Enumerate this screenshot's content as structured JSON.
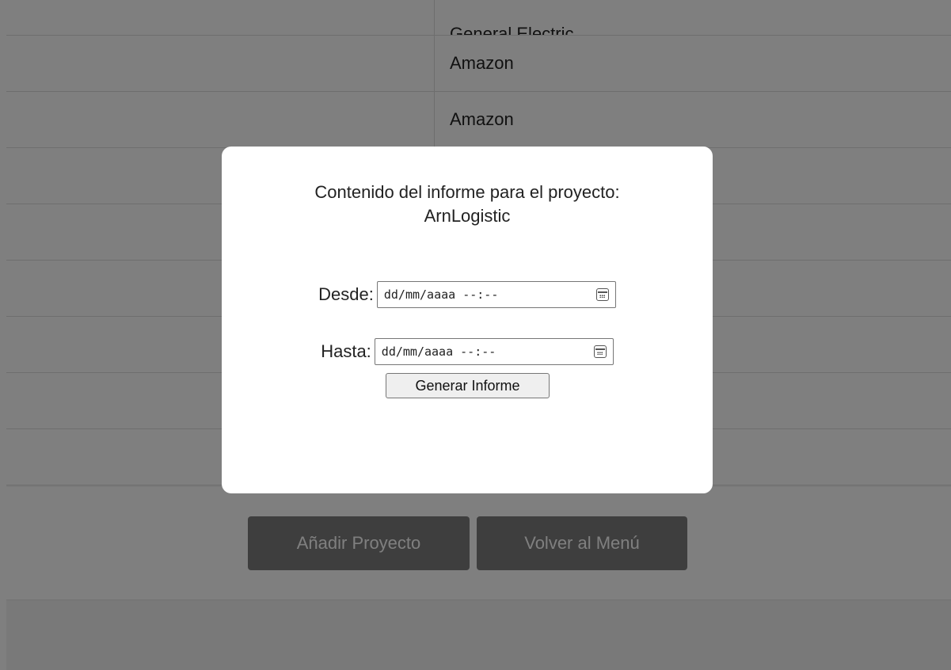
{
  "table": {
    "rows": [
      {
        "company": "General Electric"
      },
      {
        "company": "Amazon"
      },
      {
        "company": "Amazon"
      },
      {
        "company": ""
      },
      {
        "company": ""
      },
      {
        "company": ""
      },
      {
        "company": ""
      },
      {
        "company": ""
      },
      {
        "company": ""
      }
    ]
  },
  "actions": {
    "add_project": "Añadir Proyecto",
    "back_to_menu": "Volver al Menú"
  },
  "modal": {
    "title_line1": "Contenido del informe para el proyecto:",
    "title_line2": "ArnLogistic",
    "from_label": "Desde:",
    "to_label": "Hasta:",
    "from_placeholder": "dd/mm/aaaa --:--",
    "to_placeholder": "dd/mm/aaaa --:--",
    "generate_button": "Generar Informe",
    "calendar_icon": "calendar-icon"
  }
}
